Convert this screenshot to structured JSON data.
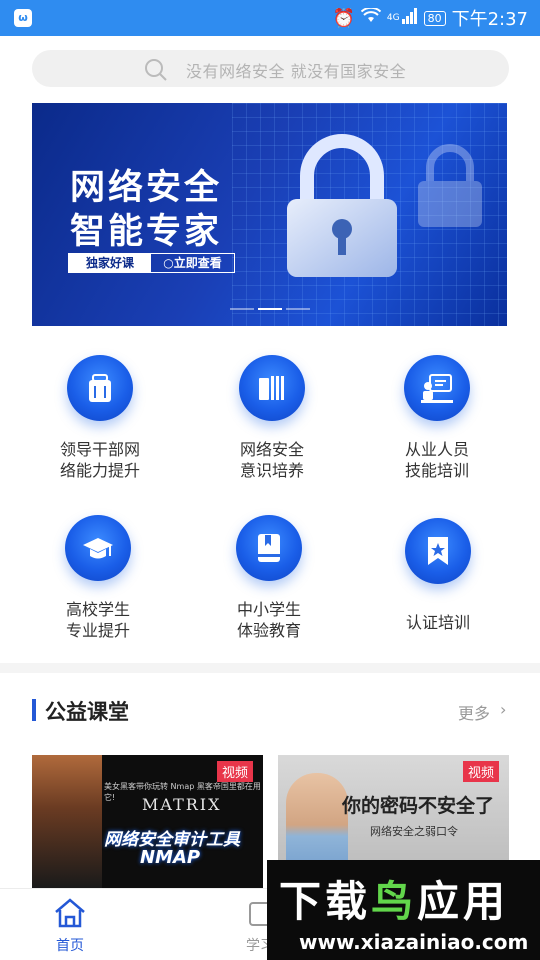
{
  "status_bar": {
    "app_icon_glyph": "ω",
    "network": "4G",
    "battery": "80",
    "time": "下午2:37"
  },
  "search": {
    "placeholder": "没有网络安全 就没有国家安全"
  },
  "banner": {
    "title_line1": "网络安全",
    "title_line2": "智能专家",
    "tag_primary": "独家好课",
    "tag_secondary": "立即查看",
    "slide_count": 3,
    "active_slide": 2
  },
  "categories": [
    {
      "label_line1": "领导干部网",
      "label_line2": "络能力提升",
      "icon": "suitcase-icon"
    },
    {
      "label_line1": "网络安全",
      "label_line2": "意识培养",
      "icon": "books-icon"
    },
    {
      "label_line1": "从业人员",
      "label_line2": "技能培训",
      "icon": "presentation-icon"
    },
    {
      "label_line1": "高校学生",
      "label_line2": "专业提升",
      "icon": "graduation-cap-icon"
    },
    {
      "label_line1": "中小学生",
      "label_line2": "体验教育",
      "icon": "book-icon"
    },
    {
      "label_line1": "认证培训",
      "label_line2": "",
      "icon": "bookmark-star-icon"
    }
  ],
  "section": {
    "title": "公益课堂",
    "more": "更多",
    "more_icon": "›"
  },
  "videos": [
    {
      "badge": "视频",
      "tiny_text": "美女黑客带你玩转 Nmap 黑客帝国里都在用它!",
      "brand": "MATRIX",
      "headline": "网络安全审计工具",
      "sub_headline": "NMAP"
    },
    {
      "badge": "视频",
      "headline": "你的密码不安全了",
      "sub_headline": "网络安全之弱口令"
    }
  ],
  "nav": {
    "home": "首页",
    "study": "学习"
  },
  "watermark": {
    "line1_a": "下载",
    "line1_b": "鸟",
    "line1_c": "应用",
    "line2": "www.xiazainiao.com"
  },
  "colors": {
    "primary": "#2f8cf0",
    "accent": "#2458d6",
    "badge": "#e8354a"
  }
}
